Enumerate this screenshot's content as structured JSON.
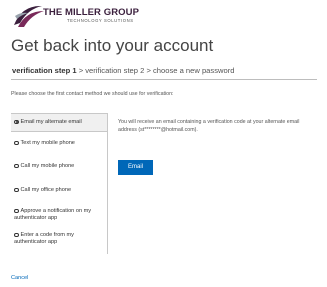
{
  "brand": {
    "name": "THE MILLER GROUP",
    "tagline": "TECHNOLOGY SOLUTIONS",
    "colors": {
      "primary": "#3b1f3d",
      "accent": "#7a2a5a"
    }
  },
  "page": {
    "title": "Get back into your account"
  },
  "steps": {
    "step1": "verification step 1",
    "sep1": " > ",
    "step2": "verification step 2",
    "sep2": " > ",
    "step3": "choose a new password"
  },
  "instruction": "Please choose the first contact method we should use for verification:",
  "options": [
    {
      "label": "Email my alternate email",
      "selected": true
    },
    {
      "label": "Text my mobile phone",
      "selected": false
    },
    {
      "label": "Call my mobile phone",
      "selected": false
    },
    {
      "label": "Call my office phone",
      "selected": false
    },
    {
      "label": "Approve a notification on my authenticator app",
      "selected": false
    },
    {
      "label": "Enter a code from my authenticator app",
      "selected": false
    }
  ],
  "detail": {
    "text": "You will receive an email containing a verification code at your alternate email address (st********@hotmail.com).",
    "button": "Email",
    "button_color": "#0067b8"
  },
  "cancel": "Cancel"
}
